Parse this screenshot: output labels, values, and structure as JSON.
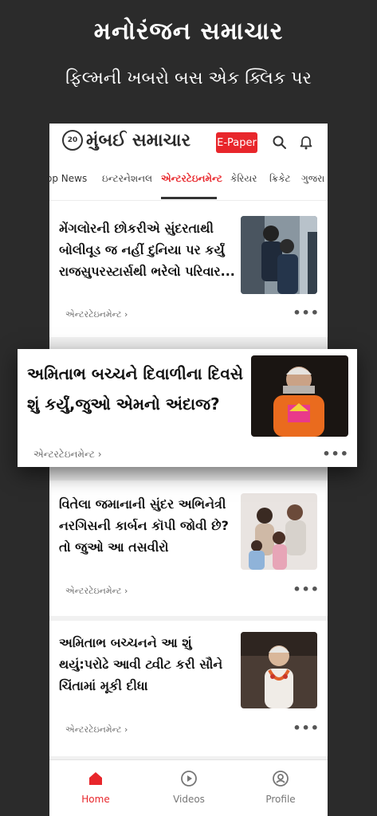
{
  "promo": {
    "title": "મનોરંજન સમાચાર",
    "subtitle": "ફિલ્મની ખબરો બસ એક ક્લિક પર"
  },
  "header": {
    "logo_badge": "20",
    "logo_text": "મુંબઈ સમાચાર",
    "epaper_label": "E-Paper",
    "icons": [
      "search-icon",
      "bell-icon"
    ]
  },
  "tabs": [
    {
      "label": "op News",
      "active": false
    },
    {
      "label": "ઇન્ટરનેશનલ",
      "active": false
    },
    {
      "label": "એન્ટરટેઇનમેન્ટ",
      "active": true
    },
    {
      "label": "કેરિયર",
      "active": false
    },
    {
      "label": "ક્રિકેટ",
      "active": false
    },
    {
      "label": "ગુજરા",
      "active": false
    }
  ],
  "articles": [
    {
      "title_lines": [
        "મેંગલોરની છોકરીએ સુંદરતાથી",
        "બોલીવૂડ જ નહીં દુનિયા પર કર્યું",
        "રાજસુપરસ્ટાર્સથી ભરેલો પરિવાર..."
      ],
      "category": "એન્ટરટેઇનમેન્ટ",
      "more": "•••"
    },
    {
      "title_lines": [
        "વિતેલા જમાનાની સુંદર અભિનેત્રી",
        "નરગિસની કાર્બન કૉપી જોવી છે?",
        "તો જુઓ આ તસવીરો"
      ],
      "category": "એન્ટરટેઇનમેન્ટ",
      "more": "•••"
    },
    {
      "title_lines": [
        "અમિતાભ બચ્ચનને આ શું",
        "થયું:પરોઢે આવી ટ્વીટ કરી સૌને",
        "ચિંતામાં મૂકી દીધા"
      ],
      "category": "એન્ટરટેઇનમેન્ટ",
      "more": "•••"
    }
  ],
  "highlight": {
    "title_lines": [
      "અમિતાભ બચ્ચને દિવાળીના દિવસે",
      "શું કર્યું,જુઓ એમનો અંદાજ?"
    ],
    "category": "એન્ટરટેઇનમેન્ટ",
    "more": "•••"
  },
  "bottom_nav": [
    {
      "label": "Home",
      "icon": "home-icon",
      "active": true
    },
    {
      "label": "Videos",
      "icon": "play-circle-icon",
      "active": false
    },
    {
      "label": "Profile",
      "icon": "profile-icon",
      "active": false
    }
  ],
  "colors": {
    "accent": "#e8262b",
    "background": "#2b2b2b"
  }
}
